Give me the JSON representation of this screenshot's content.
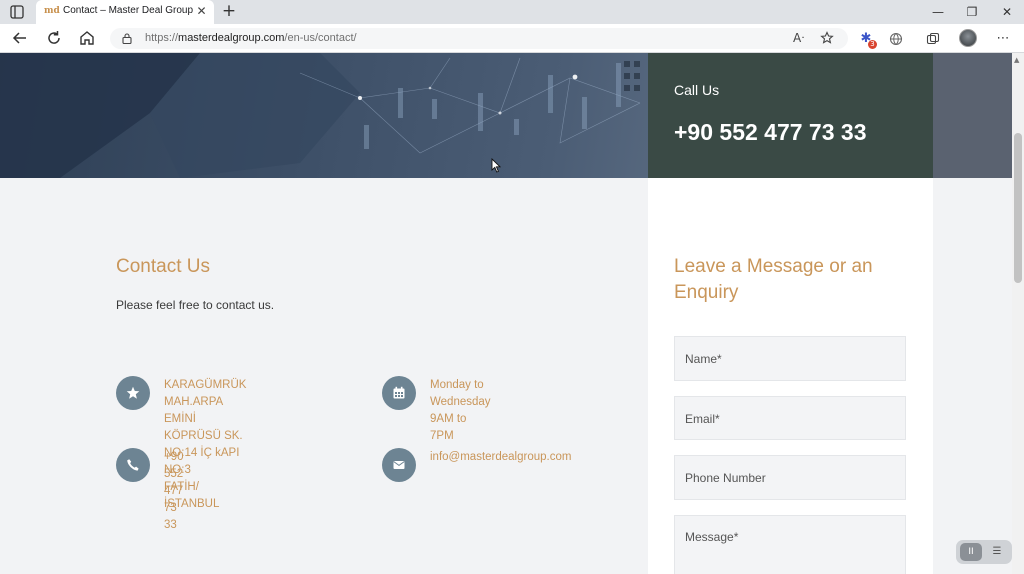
{
  "browser": {
    "tab": {
      "favicon": "md",
      "title": "Contact – Master Deal Group",
      "close": "✕"
    },
    "new_tab": "+",
    "window": {
      "minimize": "—",
      "maximize": "❐",
      "close": "✕"
    },
    "url": {
      "scheme": "https://",
      "host": "masterdealgroup.com",
      "path": "/en-us/contact/"
    },
    "extension_badge": "3",
    "icons": [
      "back-icon",
      "refresh-icon",
      "home-icon",
      "lock-icon",
      "read-aloud-icon",
      "favorite-icon",
      "extension-icon",
      "globe-icon",
      "collections-icon",
      "profile-avatar",
      "more-icon"
    ]
  },
  "hero": {
    "call_label": "Call Us",
    "call_number": "+90 552 477 73 33"
  },
  "contact": {
    "title": "Contact Us",
    "subtitle": "Please feel free to contact us.",
    "address": "KARAGÜMRÜK MAH.ARPA EMİNİ\nKÖPRÜSÜ SK. NO:14 İÇ kAPI NO:3\nFATİH/İSTANBUL",
    "hours": "Monday to Wednesday\n9AM to 7PM",
    "phone": "+90 552 477 73 33",
    "email": "info@masterdealgroup.com"
  },
  "form": {
    "title": "Leave a Message or an Enquiry",
    "name_placeholder": "Name*",
    "email_placeholder": "Email*",
    "phone_placeholder": "Phone Number",
    "message_placeholder": "Message*"
  },
  "floating": {
    "pause": "II",
    "other": "☰"
  },
  "colors": {
    "accent": "#c9965a",
    "call_panel": "#3a4a45",
    "icon_circle": "#6d8493"
  }
}
